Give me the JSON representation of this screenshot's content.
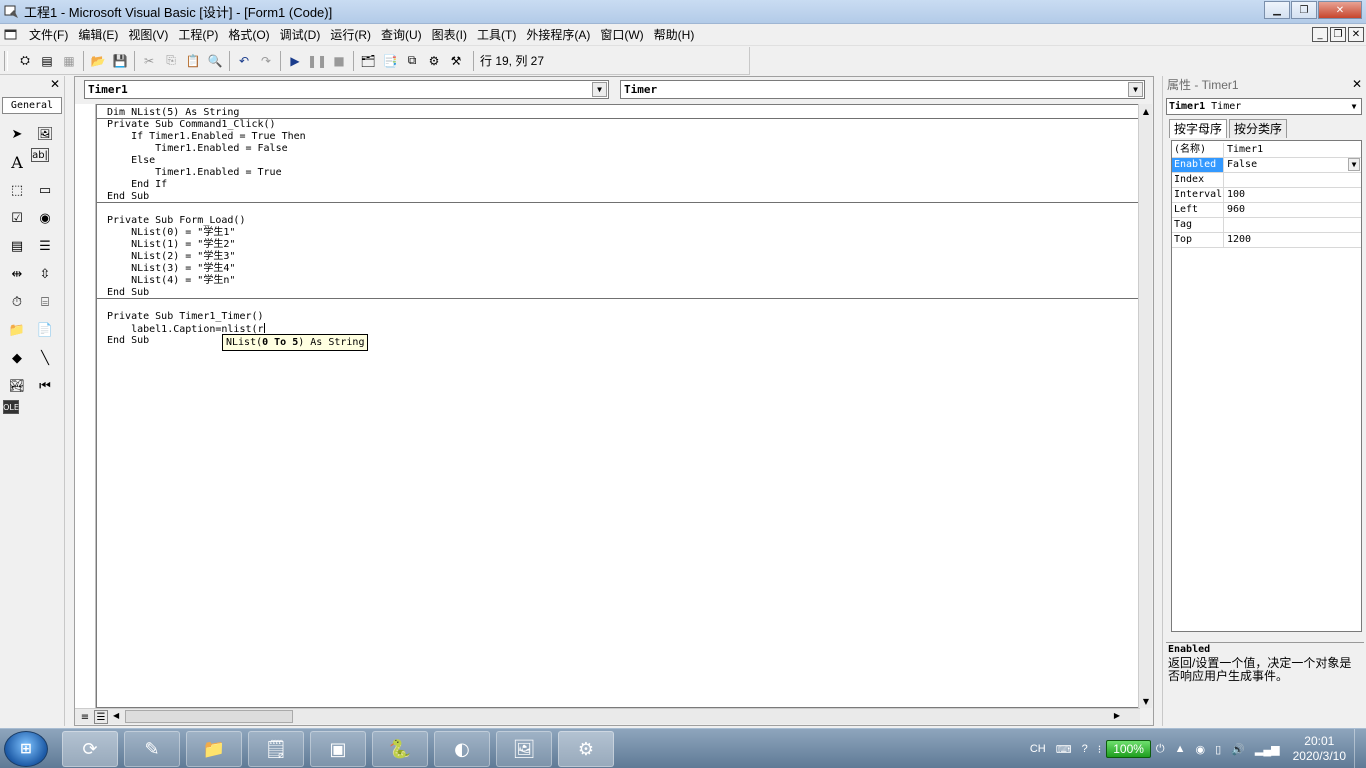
{
  "window": {
    "title": "工程1 - Microsoft Visual Basic [设计] - [Form1 (Code)]",
    "icon": "vb-app-icon"
  },
  "menu": {
    "items": [
      "文件(F)",
      "编辑(E)",
      "视图(V)",
      "工程(P)",
      "格式(O)",
      "调试(D)",
      "运行(R)",
      "查询(U)",
      "图表(I)",
      "工具(T)",
      "外接程序(A)",
      "窗口(W)",
      "帮助(H)"
    ]
  },
  "toolbar": {
    "cursor_position": "行 19, 列 27"
  },
  "toolbox": {
    "tab_label": "General"
  },
  "code_window": {
    "object_combo": "Timer1",
    "procedure_combo": "Timer",
    "lines": [
      "Dim NList(5) As String",
      "Private Sub Command1_Click()",
      "    If Timer1.Enabled = True Then",
      "        Timer1.Enabled = False",
      "    Else",
      "        Timer1.Enabled = True",
      "    End If",
      "End Sub",
      "",
      "Private Sub Form_Load()",
      "    NList(0) = \"学生1\"",
      "    NList(1) = \"学生2\"",
      "    NList(2) = \"学生3\"",
      "    NList(3) = \"学生4\"",
      "    NList(4) = \"学生n\"",
      "End Sub",
      "",
      "Private Sub Timer1_Timer()",
      "    label1.Caption=nlist(r",
      "End Sub"
    ],
    "tooltip": {
      "prefix": "NList(",
      "bold": "0 To 5",
      "suffix": ") As String"
    }
  },
  "properties": {
    "title": "属性 - Timer1",
    "object_name": "Timer1",
    "object_type": "Timer",
    "tabs": [
      "按字母序",
      "按分类序"
    ],
    "rows": [
      {
        "name": "(名称)",
        "value": "Timer1"
      },
      {
        "name": "Enabled",
        "value": "False"
      },
      {
        "name": "Index",
        "value": ""
      },
      {
        "name": "Interval",
        "value": "100"
      },
      {
        "name": "Left",
        "value": "960"
      },
      {
        "name": "Tag",
        "value": ""
      },
      {
        "name": "Top",
        "value": "1200"
      }
    ],
    "description_name": "Enabled",
    "description_text": "返回/设置一个值，决定一个对象是否响应用户生成事件。"
  },
  "taskbar": {
    "language": "CH",
    "battery": "100%",
    "time": "20:01",
    "date": "2020/3/10"
  }
}
